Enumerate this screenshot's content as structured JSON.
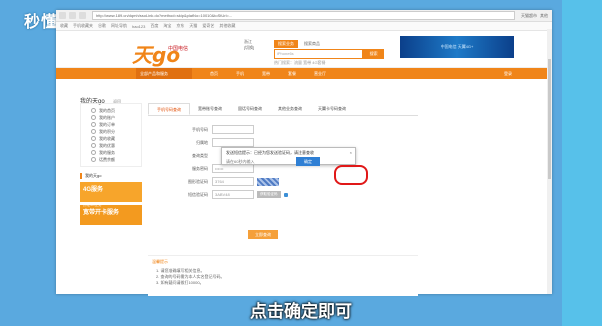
{
  "watermark": "秒懂视频",
  "caption": "点击确定即可",
  "browser": {
    "url": "http://www.189.cn/dqmh/ssoLink.do?method=skip&platNo=10010&toStUrl=...",
    "top_right": [
      "天猫超市",
      "其他"
    ],
    "bookmarks": [
      "收藏",
      "手机收藏夹",
      "谷歌",
      "网址导航",
      "hao123",
      "百度",
      "淘宝",
      "京东",
      "天猫",
      "爱奇艺",
      "其他收藏"
    ]
  },
  "header": {
    "logo": "天go",
    "logo_sub": "中国电信",
    "city_lines": [
      "浙江",
      "[切换]"
    ],
    "search_tabs": [
      "搜索业务",
      "搜索商品"
    ],
    "search_placeholder": "iPhone6s",
    "search_btn": "搜索",
    "hot": "热门搜索：流量 宽带 4G套餐",
    "banner": "中国电信 天翼4G+"
  },
  "nav": {
    "all": "全部产品和服务",
    "items": [
      "首页",
      "手机",
      "宽带",
      "套餐",
      "营业厅"
    ],
    "login": "登录"
  },
  "page_title": "我的天go",
  "page_sub": "返回",
  "sidebar": {
    "items": [
      "我的首页",
      "我的账户",
      "我的订单",
      "我的积分",
      "我的收藏",
      "我的优惠",
      "我的服务",
      "话费余额"
    ],
    "section": "我的天go",
    "promo1_title": "4G服务",
    "promo1_sub": "办理4G业务",
    "promo2_title": "宽带开卡服务",
    "promo2_sub": "办理宽带业务"
  },
  "tabs": [
    "手机号码查询",
    "宽带账号查询",
    "固话号码查询",
    "其他业务查询",
    "天翼卡号码查询"
  ],
  "form": {
    "phone_label": "手机号码",
    "phone_value": "",
    "city_label": "归属地",
    "city_value": "",
    "type_label": "查询类型",
    "pwd_label": "服务密码",
    "pwd_value": "••••••",
    "code_label": "图形验证码",
    "code_value": "3764",
    "sms_label": "短信验证码",
    "sms_value": "3ABV48",
    "sms_btn": "获取验证码",
    "submit": "立即查询"
  },
  "dropdown": {
    "line1": "发送短信提示：已经为您发送验证码，请注意查收",
    "line2": "请在60秒内输入",
    "ok": "确定"
  },
  "notice": {
    "title": "温馨提示",
    "lines": [
      "1. 请您准确填写相关信息。",
      "2. 查询的号码需为本人实名登记号码。",
      "3. 如有疑问请拨打10000。"
    ]
  }
}
